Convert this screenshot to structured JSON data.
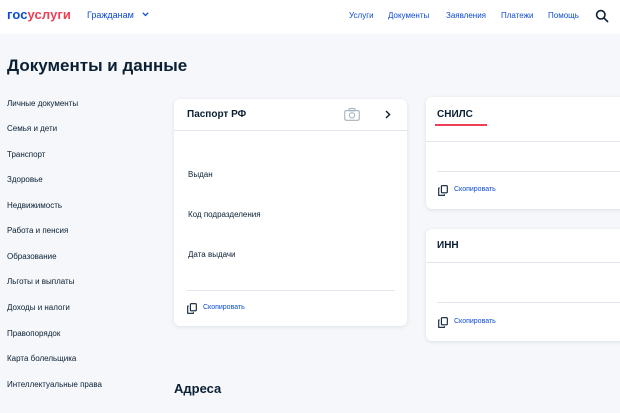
{
  "header": {
    "logo_part1": "гос",
    "logo_part2": "услуги",
    "audience": "Гражданам",
    "nav": [
      "Услуги",
      "Документы",
      "Заявления",
      "Платежи",
      "Помощь"
    ]
  },
  "page": {
    "title": "Документы и данные"
  },
  "sidebar": {
    "items": [
      "Личные документы",
      "Семья и дети",
      "Транспорт",
      "Здоровье",
      "Недвижимость",
      "Работа и пенсия",
      "Образование",
      "Льготы и выплаты",
      "Доходы и налоги",
      "Правопорядок",
      "Карта болельщика",
      "Интеллектуальные права"
    ]
  },
  "passport": {
    "title": "Паспорт РФ",
    "fields": [
      "Выдан",
      "Код подразделения",
      "Дата выдачи"
    ],
    "copy_label": "Скопировать"
  },
  "snils": {
    "title": "СНИЛС",
    "copy_label": "Скопировать"
  },
  "inn": {
    "title": "ИНН",
    "copy_label": "Скопировать"
  },
  "addresses": {
    "title": "Адреса"
  },
  "colors": {
    "brand_blue": "#0d4cd3",
    "brand_red": "#ee3f58",
    "text": "#0b1f33"
  }
}
